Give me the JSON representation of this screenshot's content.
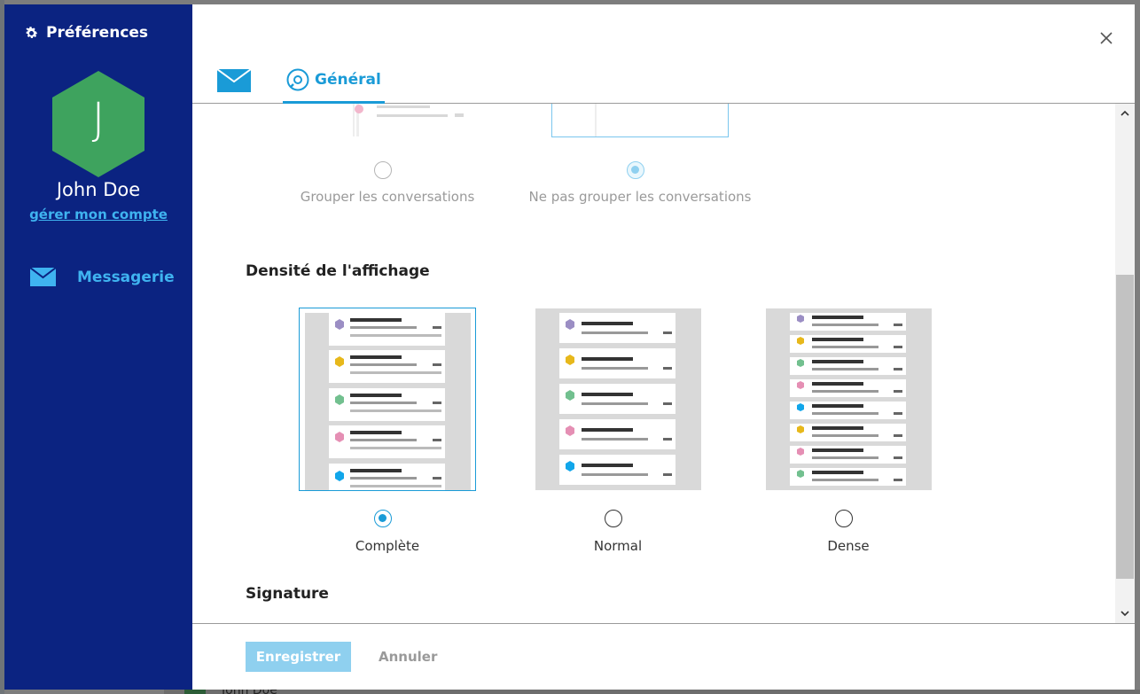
{
  "sidebar": {
    "title": "Préférences",
    "avatar_initial": "J",
    "user_name": "John Doe",
    "manage_link": "gérer mon compte",
    "nav": [
      {
        "label": "Messagerie",
        "icon": "envelope-icon"
      }
    ]
  },
  "tabs": [
    {
      "label": "",
      "icon": "envelope-icon"
    },
    {
      "label": "Général",
      "icon": "wrench-cog-icon",
      "active": true
    }
  ],
  "grouping": {
    "options": [
      {
        "label": "Grouper les conversations",
        "checked": false
      },
      {
        "label": "Ne pas grouper les conversations",
        "checked": true
      }
    ]
  },
  "density": {
    "title": "Densité de l'affichage",
    "options": [
      {
        "label": "Complète",
        "checked": true
      },
      {
        "label": "Normal",
        "checked": false
      },
      {
        "label": "Dense",
        "checked": false
      }
    ]
  },
  "signature": {
    "title": "Signature"
  },
  "footer": {
    "save_label": "Enregistrer",
    "cancel_label": "Annuler"
  },
  "background": {
    "user_name": "John Doe"
  },
  "colors": {
    "sidebar_bg": "#0b2381",
    "accent": "#1a9bd7",
    "link": "#3fb3f0",
    "avatar": "#3ea35e",
    "hex_purple": "#9b8ec4",
    "hex_yellow": "#e7b81b",
    "hex_green": "#72c08f",
    "hex_pink": "#e58fb4",
    "hex_blue": "#11a6ea"
  }
}
